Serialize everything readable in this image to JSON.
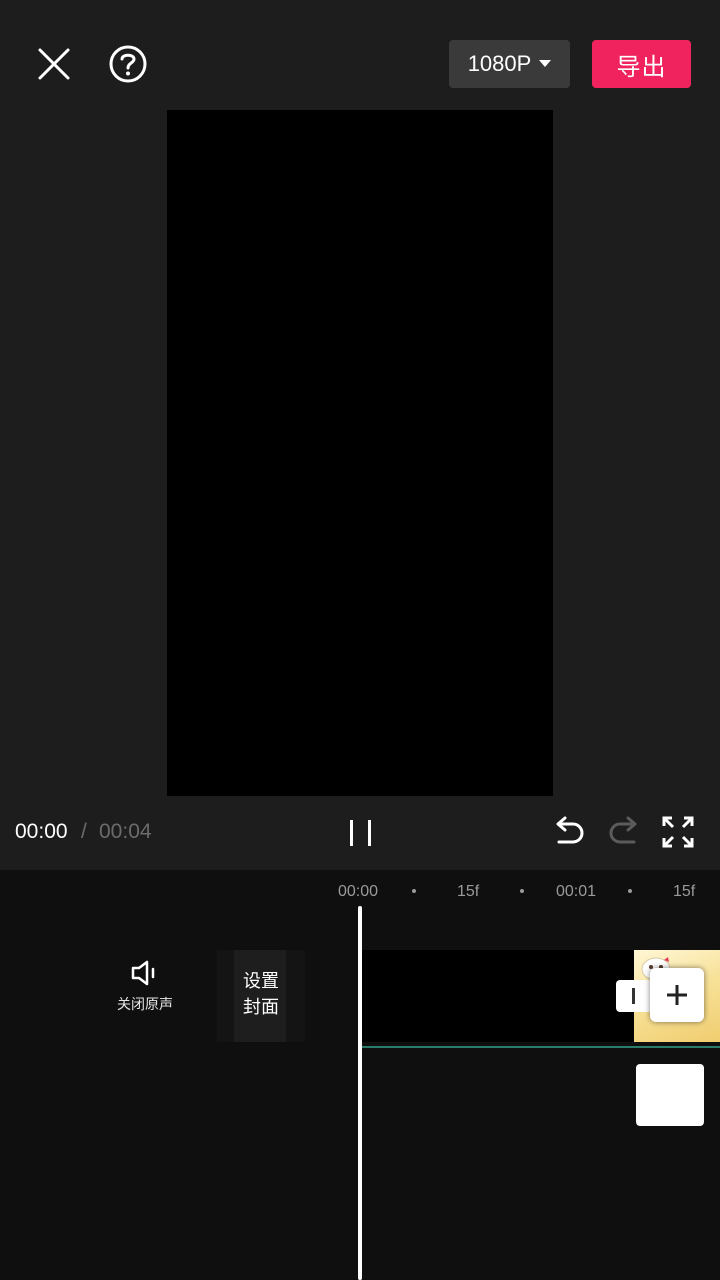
{
  "header": {
    "resolution_label": "1080P",
    "export_label": "导出",
    "close_icon": "close-icon",
    "help_icon": "help-icon"
  },
  "playback": {
    "current_time": "00:00",
    "separator": "/",
    "total_time": "00:04"
  },
  "ruler": {
    "labels": [
      "00:00",
      "15f",
      "00:01",
      "15f"
    ]
  },
  "timeline": {
    "mute_label": "关闭原声",
    "cover_label_line1": "设置",
    "cover_label_line2": "封面"
  },
  "colors": {
    "accent": "#f0235f",
    "background": "#1d1d1d",
    "timeline_bg": "#0f0f0f"
  }
}
